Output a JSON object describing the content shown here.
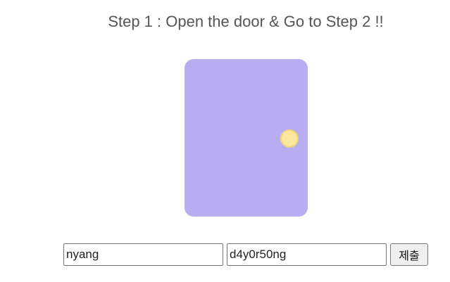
{
  "header": {
    "title": "Step 1 : Open the door & Go to Step 2 !!"
  },
  "door": {
    "color": "#b7adf0",
    "knob_color": "#fce89d"
  },
  "form": {
    "id_value": "nyang",
    "password_value": "d4y0r50ng",
    "submit_label": "제출"
  }
}
